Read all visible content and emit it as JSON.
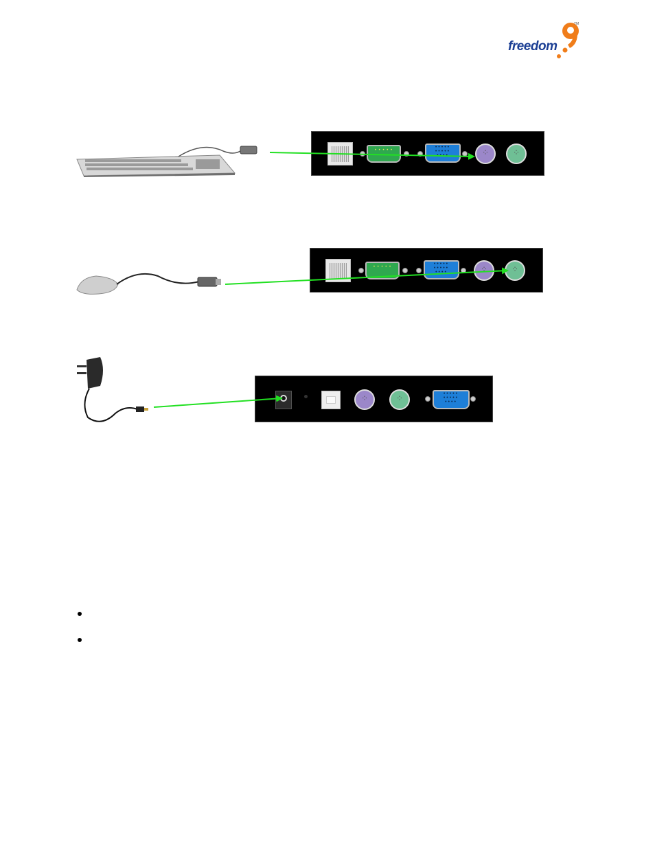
{
  "header": {
    "logo": {
      "wordmark": "freedom",
      "numeral": "9",
      "trademark": "TM",
      "colors": {
        "wordmark": "#1c3f94",
        "numeral": "#f07d1a"
      }
    }
  },
  "diagrams": [
    {
      "id": "keyboard-connection",
      "device": "keyboard",
      "target_port": "ps2-keyboard",
      "panel_ports": [
        "rj-port",
        "serial-db9",
        "vga-db15",
        "ps2-keyboard",
        "ps2-mouse"
      ],
      "arrow_color": "#22e022"
    },
    {
      "id": "mouse-connection",
      "device": "mouse",
      "target_port": "ps2-mouse",
      "panel_ports": [
        "rj-port",
        "serial-db9",
        "vga-db15",
        "ps2-keyboard",
        "ps2-mouse"
      ],
      "arrow_color": "#22e022"
    },
    {
      "id": "power-connection",
      "device": "power-adapter",
      "target_port": "dc-power-jack",
      "panel_ports": [
        "dc-power-jack",
        "led-indicator",
        "usb-b",
        "ps2-keyboard",
        "ps2-mouse",
        "vga-db15"
      ],
      "arrow_color": "#22e022"
    }
  ],
  "bullets": [
    {
      "text": ""
    },
    {
      "text": ""
    }
  ]
}
